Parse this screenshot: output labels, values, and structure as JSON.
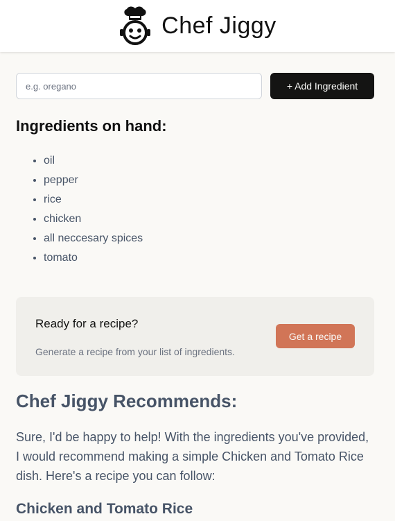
{
  "header": {
    "app_title": "Chef Jiggy",
    "logo_icon": "chef-hat-face-icon"
  },
  "add_ingredient": {
    "placeholder": "e.g. oregano",
    "value": "",
    "button_label": "+ Add Ingredient"
  },
  "ingredients": {
    "heading": "Ingredients on hand:",
    "items": [
      "oil",
      "pepper",
      "rice",
      "chicken",
      "all neccesary spices",
      "tomato"
    ]
  },
  "recipe_cta": {
    "title": "Ready for a recipe?",
    "description": "Generate a recipe from your list of ingredients.",
    "button_label": "Get a recipe"
  },
  "recommendation": {
    "heading": "Chef Jiggy Recommends:",
    "intro": "Sure, I'd be happy to help! With the ingredients you've provided, I would recommend making a simple Chicken and Tomato Rice dish. Here's a recipe you can follow:",
    "recipe_title": "Chicken and Tomato Rice"
  },
  "colors": {
    "background": "#FAF9F6",
    "dark_button": "#141413",
    "accent": "#D17557",
    "cta_panel": "#F0EFEB",
    "muted_text": "#475467"
  }
}
